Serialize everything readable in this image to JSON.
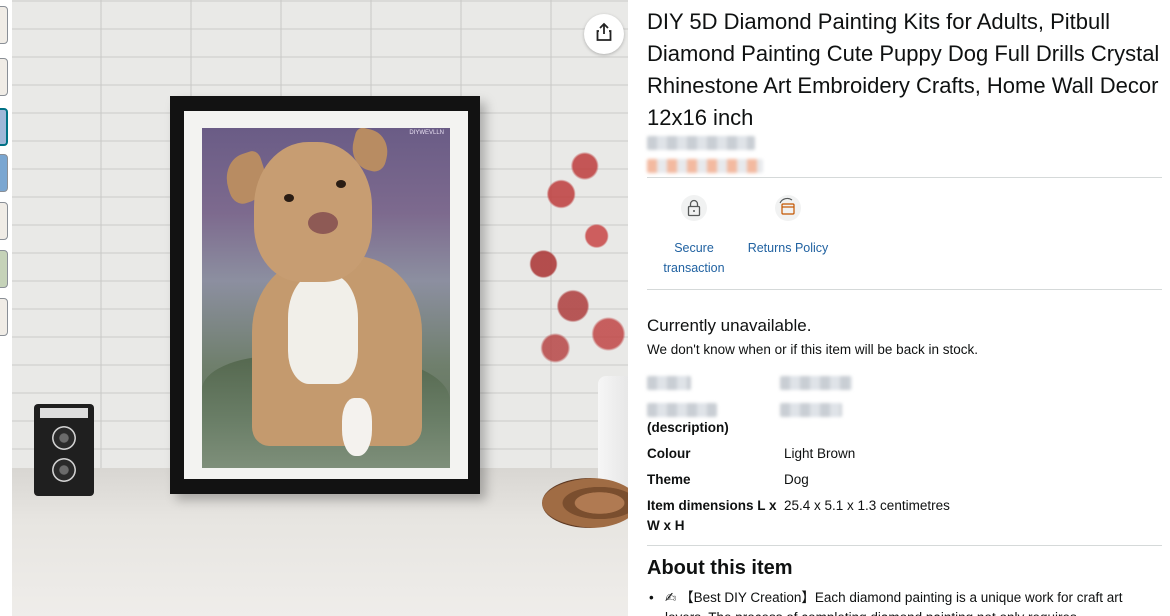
{
  "product": {
    "title": "DIY 5D Diamond Painting Kits for Adults, Pitbull Diamond Painting Cute Puppy Dog Full Drills Crystal Rhinestone Art Embroidery Crafts, Home Wall Decor 12x16 inch",
    "image_tag": "DIYWEVLLN"
  },
  "trust": {
    "secure_label": "Secure transaction",
    "returns_label": "Returns Policy",
    "secure_icon": "lock-icon",
    "returns_icon": "return-box-icon"
  },
  "availability": {
    "headline": "Currently unavailable.",
    "subtext": "We don't know when or if this item will be back in stock."
  },
  "specs": {
    "description_label": "(description)",
    "rows": [
      {
        "label": "Colour",
        "value": "Light Brown"
      },
      {
        "label": "Theme",
        "value": "Dog"
      },
      {
        "label": "Item dimensions L x W x H",
        "value": "25.4 x 5.1 x 1.3 centimetres"
      }
    ]
  },
  "about": {
    "heading": "About this item",
    "bullets": [
      {
        "icon": "✍",
        "text": "【Best DIY Creation】Each diamond painting is a unique work for craft art lovers. The process of completing diamond painting not only requires"
      }
    ]
  },
  "colors": {
    "link": "#2162a1",
    "text": "#0f1111",
    "divider": "#d5d9d9"
  },
  "icons": {
    "share": "share-icon"
  }
}
